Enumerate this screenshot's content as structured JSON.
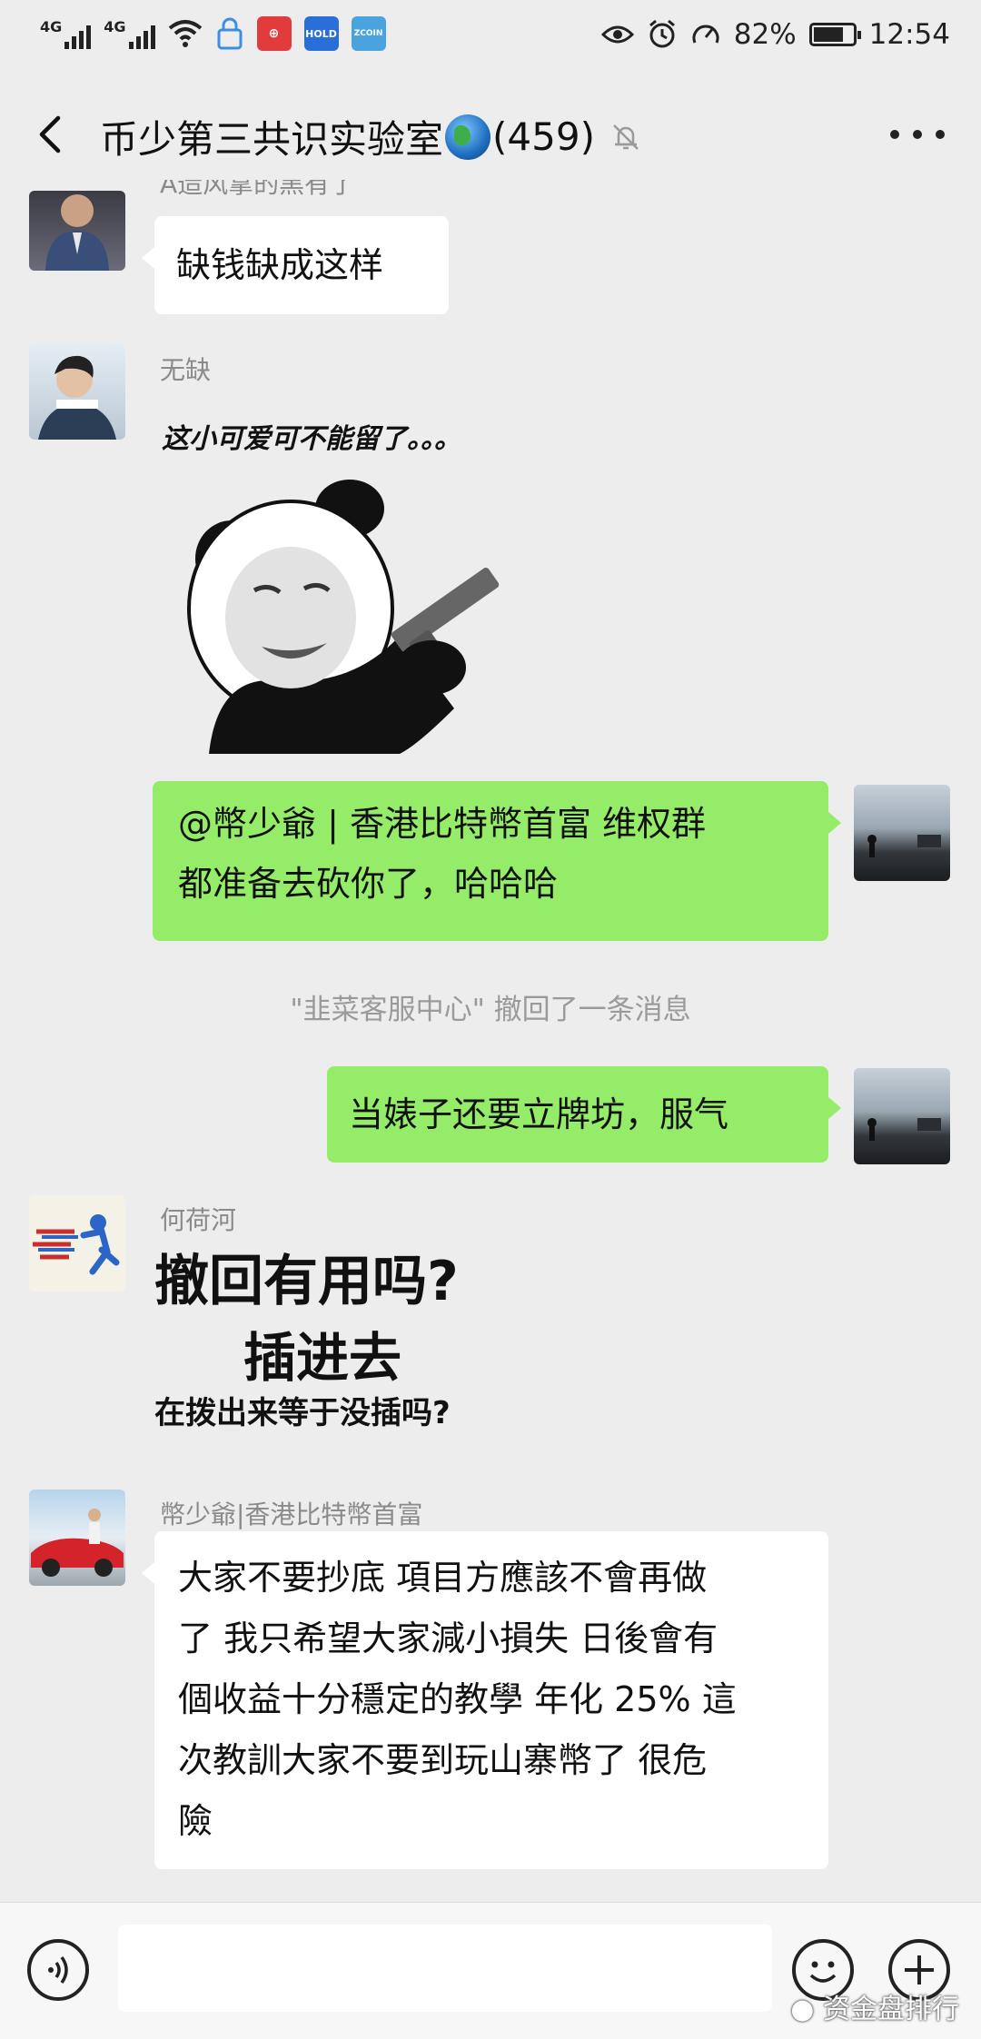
{
  "status_bar": {
    "net1": "4G",
    "net2": "4G",
    "app_icon_1": "HOLD",
    "app_icon_2": "ZCOIN",
    "battery": "82%",
    "battery_level": 0.82,
    "time": "12:54",
    "icons": [
      "signal-icon",
      "wifi-icon",
      "eye-icon",
      "alarm-icon",
      "speed-icon",
      "battery-icon"
    ]
  },
  "header": {
    "title_prefix": "币少第三共识实验室",
    "title_suffix": "(459)",
    "icons": [
      "back-icon",
      "globe-icon",
      "mute-icon",
      "more-icon"
    ]
  },
  "messages": {
    "m1": {
      "sender_partial": "A造风拿的黑有了",
      "text": "缺钱缺成这样"
    },
    "m2": {
      "sender": "无缺",
      "caption": "这小可爱可不能留了。。。",
      "sticker": "panda-gun-sticker"
    },
    "m3": {
      "line1": "@幣少爺 | 香港比特幣首富  维权群",
      "line2": "都准备去砍你了，哈哈哈"
    },
    "system": "\"韭菜客服中心\" 撤回了一条消息",
    "m4": {
      "text": "当婊子还要立牌坊，服气"
    },
    "m5": {
      "sender": "何荷河",
      "line1": "撤回有用吗?",
      "line2": "插进去",
      "line3": "在拨出来等于没插吗?"
    },
    "m6": {
      "sender": "幣少爺|香港比特幣首富",
      "lines": [
        "大家不要抄底 項目方應該不會再做",
        "了 我只希望大家減小損失 日後會有",
        "個收益十分穩定的教學 年化 25% 這",
        "次教訓大家不要到玩山寨幣了 很危",
        "險"
      ]
    }
  },
  "bottom_bar": {
    "icons": [
      "voice-icon",
      "emoji-icon",
      "add-icon"
    ],
    "watermark": "资金盘排行"
  }
}
